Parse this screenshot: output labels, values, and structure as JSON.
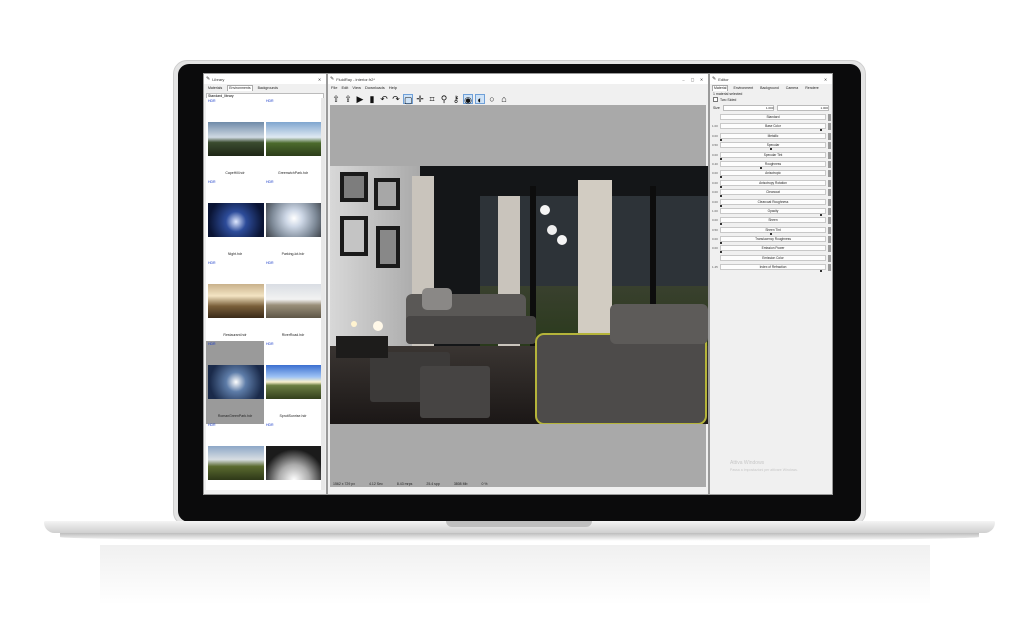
{
  "library": {
    "title": "Library",
    "tabs": [
      "Materials",
      "Environments",
      "Backgrounds"
    ],
    "active_tab": 1,
    "category": "Standard_library",
    "items": [
      {
        "badge": "HDR",
        "name": "CapeHill.hdr"
      },
      {
        "badge": "HDR",
        "name": "GreenwichPark.hdr"
      },
      {
        "badge": "HDR",
        "name": "Night.hdr"
      },
      {
        "badge": "HDR",
        "name": "Parking-lot.hdr"
      },
      {
        "badge": "HDR",
        "name": "Restaurant.hdr"
      },
      {
        "badge": "HDR",
        "name": "RiverRoad.hdr"
      },
      {
        "badge": "HDR",
        "name": "RomanGreenPark.hdr"
      },
      {
        "badge": "HDR",
        "name": "SpruitSunrise.hdr"
      },
      {
        "badge": "HDR",
        "name": ""
      },
      {
        "badge": "HDR",
        "name": ""
      }
    ]
  },
  "main": {
    "title": "FluidRay - interior.fr2*",
    "menu": [
      "File",
      "Edit",
      "View",
      "Downloads",
      "Help"
    ],
    "toolbar": [
      "arrow-up-icon",
      "home-arrow-icon",
      "play-icon",
      "save-icon",
      "undo-icon",
      "redo-icon",
      "frame-icon",
      "move-icon",
      "crosshair-icon",
      "zoom-icon",
      "picker-icon",
      "sphere-icon",
      "sphere-half-icon",
      "circle-icon",
      "graduation-cap-icon"
    ],
    "status": [
      "1562 x 729 px",
      "4.12 Sec",
      "8.43 mrps",
      "25.4 spp",
      "3808 Mb",
      "0 %"
    ]
  },
  "editor": {
    "title": "Editor",
    "tabs": [
      "Material",
      "Environment",
      "Background",
      "Camera",
      "Rendere"
    ],
    "selection": "1 material selected",
    "two_sided_label": "Two Sided",
    "size_label": "Size",
    "size_values": [
      "1.000",
      "1.000"
    ],
    "rows": [
      {
        "label": "Standard",
        "value": ""
      },
      {
        "label": "Base Color",
        "value": "1.00"
      },
      {
        "label": "Metallic",
        "value": "0.00"
      },
      {
        "label": "Specular",
        "value": "0.50"
      },
      {
        "label": "Specular Tint",
        "value": "0.00"
      },
      {
        "label": "Roughness",
        "value": "0.40"
      },
      {
        "label": "Anisotropic",
        "value": "0.00"
      },
      {
        "label": "Anisotropy Rotation",
        "value": "0.00"
      },
      {
        "label": "Clearcoat",
        "value": "0.00"
      },
      {
        "label": "Clearcoat Roughness",
        "value": "0.00"
      },
      {
        "label": "Opacity",
        "value": "1.00"
      },
      {
        "label": "Sheen",
        "value": "0.00"
      },
      {
        "label": "Sheen Tint",
        "value": "0.50"
      },
      {
        "label": "Translucency Roughness",
        "value": "0.00"
      },
      {
        "label": "Emission Power",
        "value": "0.00"
      },
      {
        "label": "Emission Color",
        "value": ""
      },
      {
        "label": "Index of Refraction",
        "value": "1.45"
      }
    ],
    "watermark_title": "Attiva Windows",
    "watermark_sub": "Passa a Impostazioni per attivare Windows."
  }
}
